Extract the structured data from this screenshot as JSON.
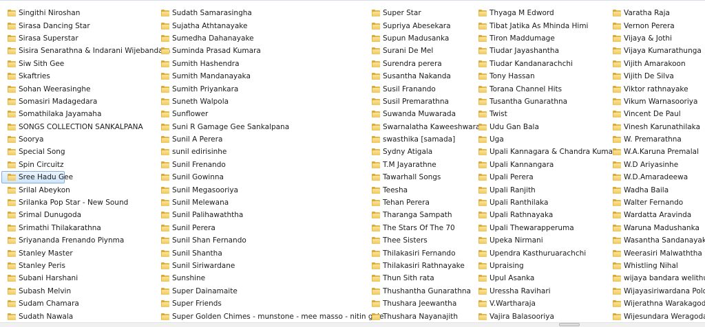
{
  "folder_view": {
    "columns": [
      [
        "Singithi Niroshan",
        "Sirasa Dancing Star",
        "Sirasa Superstar",
        "Sisira Senarathna & Indarani Wijebandara",
        "Siw Sith Gee",
        "Skaftries",
        "Sohan Weerasinghe",
        "Somasiri Madagedara",
        "Somathilaka Jayamaha",
        "SONGS COLLECTION SANKALPANA",
        "Soorya",
        "Special Song",
        "Spin Circuitz",
        "Sree Hadu Gee",
        "Srilal Abeykon",
        "Srilanka Pop Star - New Sound",
        "Srimal Dunugoda",
        "Srimathi Thilakarathna",
        "Sriyananda Frenando Piynma",
        "Stanley Master",
        "Stanley Peris",
        "Subani Harshani",
        "Subash Melvin",
        "Sudam Chamara",
        "Sudath Nawala"
      ],
      [
        "Sudath Samarasingha",
        "Sujatha Athtanayake",
        "Sumedha Dahanayake",
        "Suminda Prasad Kumara",
        "Sumith Hashendra",
        "Sumith Mandanayaka",
        "Sumith Priyankara",
        "Suneth Walpola",
        "Sunflower",
        "Suni R Gamage Gee Sankalpana",
        "Sunil A Perera",
        "sunil edirisinhe",
        "Sunil Frenando",
        "Sunil Gowinna",
        "Sunil Megasooriya",
        "Sunil Melewana",
        "Sunil Palihawaththa",
        "Sunil Perera",
        "Sunil Shan Fernando",
        "Sunil Shantha",
        "Sunil Siriwardane",
        "Sunshine",
        "Super Dainamaite",
        "Super Friends",
        "Super Golden  Chimes - munstone - mee masso - nitin gale"
      ],
      [
        "Super Star",
        "Supriya Abesekara",
        "Supun Madusanka",
        "Surani De Mel",
        "Surendra perera",
        "Susantha Nakanda",
        "Susil Franando",
        "Susil Premarathna",
        "Suwanda Muwarada",
        "Swarnalatha Kaweeshwara",
        "swasthika [samada]",
        "Sydny Atigala",
        "T.M Jayarathne",
        "Tawarhall Songs",
        "Teesha",
        "Tehan Perera",
        "Tharanga Sampath",
        "The Stars Of The 70",
        "Thee Sisters",
        "Thilakasiri Fernando",
        "Thilakasiri Rathnayake",
        "Thun Sith rata",
        "Thushantha Gunarathna",
        "Thushara Jeewantha",
        "Thushara Nayanajith"
      ],
      [
        "Thyaga M Edword",
        "Tibat Jatika As Mhinda Himi",
        "Tiron Maddumage",
        "Tiudar Jayashantha",
        "Tiudar Kandanarachchi",
        "Tony Hassan",
        "Torana Channel Hits",
        "Tusantha Gunarathna",
        "Twist",
        "Udu Gan Bala",
        "Uga",
        "Upali Kannagara & Chandra Kumar",
        "Upali Kannangara",
        "Upali Perera",
        "Upali Ranjith",
        "Upali Ranthilaka",
        "Upali Rathnayaka",
        "Upali Thewarapperuma",
        "Upeka Nirmani",
        "Upendra Kasthuruarachchi",
        "Upraising",
        "Upul Asanka",
        "Uressha Ravihari",
        "V.Wartharaja",
        "Vajira Balasooriya"
      ],
      [
        "Varatha Raja",
        "Vernon Perera",
        "Vijaya & Jothi",
        "Vijaya Kumarathunga",
        "Vijith Amarakoon",
        "Vijith De Silva",
        "Viktor rathnayake",
        "Vikum Warnasooriya",
        "Vincent De Paul",
        "Vinesh Karunathilaka",
        "W. Premarathna",
        "W.A.Karuna Premalal",
        "W.D Ariyasinhe",
        "W.D.Amaradeewa",
        "Wadha Baila",
        "Walter Fernando",
        "Wardatta Aravinda",
        "Waruna Madushanka",
        "Wasantha Sandanayake",
        "Weerasiri Malwaththa",
        "Whistling Nihal",
        "wijaya bandara welithudu",
        "Wijayasiriwardana Polono",
        "Wijerathna Warakagoda",
        "Wijesundara Weragoda"
      ]
    ],
    "selected": "Sree Hadu Gee",
    "folder_icon_color": "#e3b94c",
    "selection_color": "#cfe6fb"
  }
}
